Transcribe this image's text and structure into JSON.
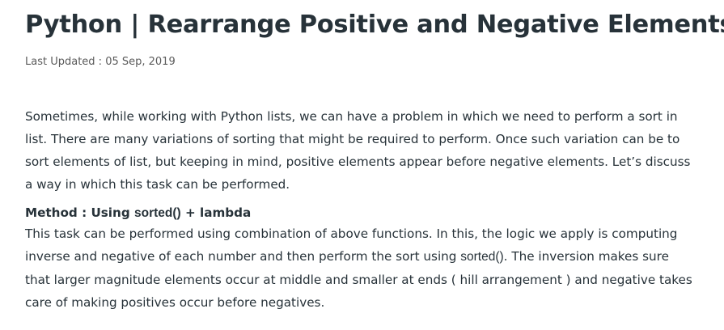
{
  "article": {
    "title": "Python | Rearrange Positive and Negative Elements",
    "last_updated": "Last Updated : 05 Sep, 2019",
    "intro": "Sometimes, while working with Python lists, we can have a problem in which we need to perform a sort in list. There are many variations of sorting that might be required to perform. Once such variation can be to sort elements of list, but keeping in mind, positive elements appear before negative elements. Let’s discuss a way in which this task can be performed.",
    "method": {
      "heading_prefix": "Method : Using ",
      "heading_code": "sorted()",
      "heading_suffix": " + lambda",
      "text_part1": "This task can be performed using combination of above functions. In this, the logic we apply is computing inverse and negative of each number and then perform the sort using ",
      "text_code": "sorted()",
      "text_part2": ". The inversion makes sure that larger magnitude elements occur at middle and smaller at ends ( hill arrangement ) and negative takes care of making positives occur before negatives."
    }
  }
}
